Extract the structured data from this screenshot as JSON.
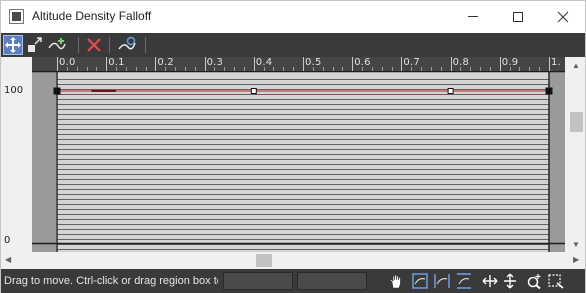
{
  "window": {
    "title": "Altitude Density Falloff"
  },
  "icons": {
    "app": "curve-editor-icon",
    "minimize": "minimize-icon",
    "maximize": "maximize-icon",
    "close": "close-icon"
  },
  "toolbar": {
    "tools": [
      {
        "name": "move-keys-tool",
        "icon": "move-arrows-icon",
        "active": true
      },
      {
        "name": "scale-keys-tool",
        "icon": "scale-keys-icon",
        "active": false
      },
      {
        "name": "insert-point-tool",
        "icon": "insert-point-icon",
        "active": false
      },
      {
        "name": "delete-points-tool",
        "icon": "delete-x-icon",
        "active": false
      },
      {
        "name": "reset-curve-tool",
        "icon": "reset-curve-icon",
        "active": false
      }
    ]
  },
  "ruler": {
    "labels": [
      "0.0",
      "0.1",
      "0.2",
      "0.3",
      "0.4",
      "0.5",
      "0.6",
      "0.7",
      "0.8",
      "0.9",
      "1."
    ]
  },
  "value_axis": {
    "top_label": "100",
    "bottom_label": "0"
  },
  "curve": {
    "x_range": [
      0.0,
      1.0
    ],
    "y_range": [
      0,
      100
    ],
    "points": [
      {
        "x": 0.0,
        "y": 100,
        "type": "corner"
      },
      {
        "x": 0.4,
        "y": 100,
        "type": "bezier"
      },
      {
        "x": 0.8,
        "y": 100,
        "type": "bezier"
      },
      {
        "x": 1.0,
        "y": 100,
        "type": "corner"
      }
    ],
    "color": "#c85a5a"
  },
  "status": {
    "hint_text": "Drag to move. Ctrl-click or drag region box to"
  },
  "statusbar_tools": [
    {
      "name": "pan-tool",
      "icon": "pan-hand-icon"
    },
    {
      "name": "zoom-extents-tool",
      "icon": "zoom-extents-icon"
    },
    {
      "name": "zoom-horizontal-extents-tool",
      "icon": "zoom-horizontal-icon"
    },
    {
      "name": "zoom-value-extents-tool",
      "icon": "zoom-value-icon"
    },
    {
      "name": "zoom-horizontal-tool",
      "icon": "horizontal-arrows-icon"
    },
    {
      "name": "zoom-vertical-tool",
      "icon": "vertical-arrows-icon"
    },
    {
      "name": "zoom-tool",
      "icon": "zoom-magnifier-icon"
    },
    {
      "name": "zoom-region-tool",
      "icon": "zoom-region-icon"
    }
  ]
}
